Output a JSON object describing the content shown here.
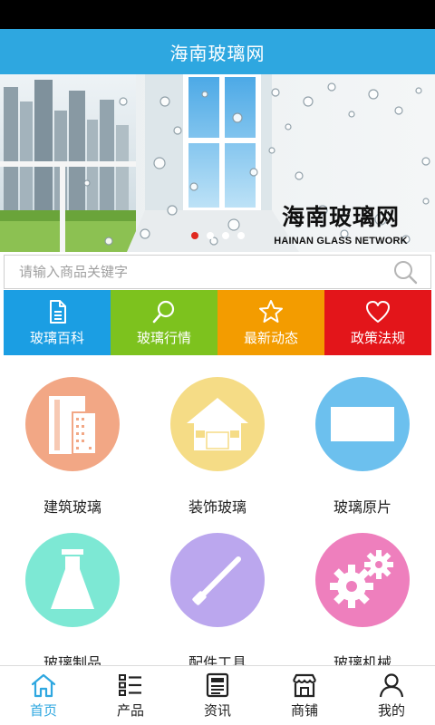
{
  "app": {
    "title": "海南玻璃网"
  },
  "banner": {
    "brand_cn": "海南玻璃网",
    "brand_en": "HAINAN GLASS NETWORK",
    "active_slide": 1,
    "slide_count": 4
  },
  "search": {
    "placeholder": "请输入商品关键字",
    "value": ""
  },
  "quick_nav": [
    {
      "label": "玻璃百科",
      "icon": "document-icon",
      "color": "#1b9ee3"
    },
    {
      "label": "玻璃行情",
      "icon": "search-icon",
      "color": "#7dc21e"
    },
    {
      "label": "最新动态",
      "icon": "star-icon",
      "color": "#f39c00"
    },
    {
      "label": "政策法规",
      "icon": "heart-icon",
      "color": "#e3151a"
    }
  ],
  "categories": [
    {
      "label": "建筑玻璃",
      "icon": "building-icon",
      "color": "#f2a785"
    },
    {
      "label": "装饰玻璃",
      "icon": "house-icon",
      "color": "#f5dc86"
    },
    {
      "label": "玻璃原片",
      "icon": "glass-sheet-icon",
      "color": "#6cc0ee"
    },
    {
      "label": "玻璃制品",
      "icon": "flask-icon",
      "color": "#7de8d4"
    },
    {
      "label": "配件工具",
      "icon": "tool-icon",
      "color": "#bba7ee"
    },
    {
      "label": "玻璃机械",
      "icon": "gears-icon",
      "color": "#ee7fbd"
    }
  ],
  "tabs": [
    {
      "label": "首页",
      "icon": "home-icon",
      "active": true
    },
    {
      "label": "产品",
      "icon": "list-icon",
      "active": false
    },
    {
      "label": "资讯",
      "icon": "news-icon",
      "active": false
    },
    {
      "label": "商铺",
      "icon": "store-icon",
      "active": false
    },
    {
      "label": "我的",
      "icon": "user-icon",
      "active": false
    }
  ],
  "colors": {
    "accent": "#2ea7e0",
    "indicator_active": "#e0281f"
  }
}
